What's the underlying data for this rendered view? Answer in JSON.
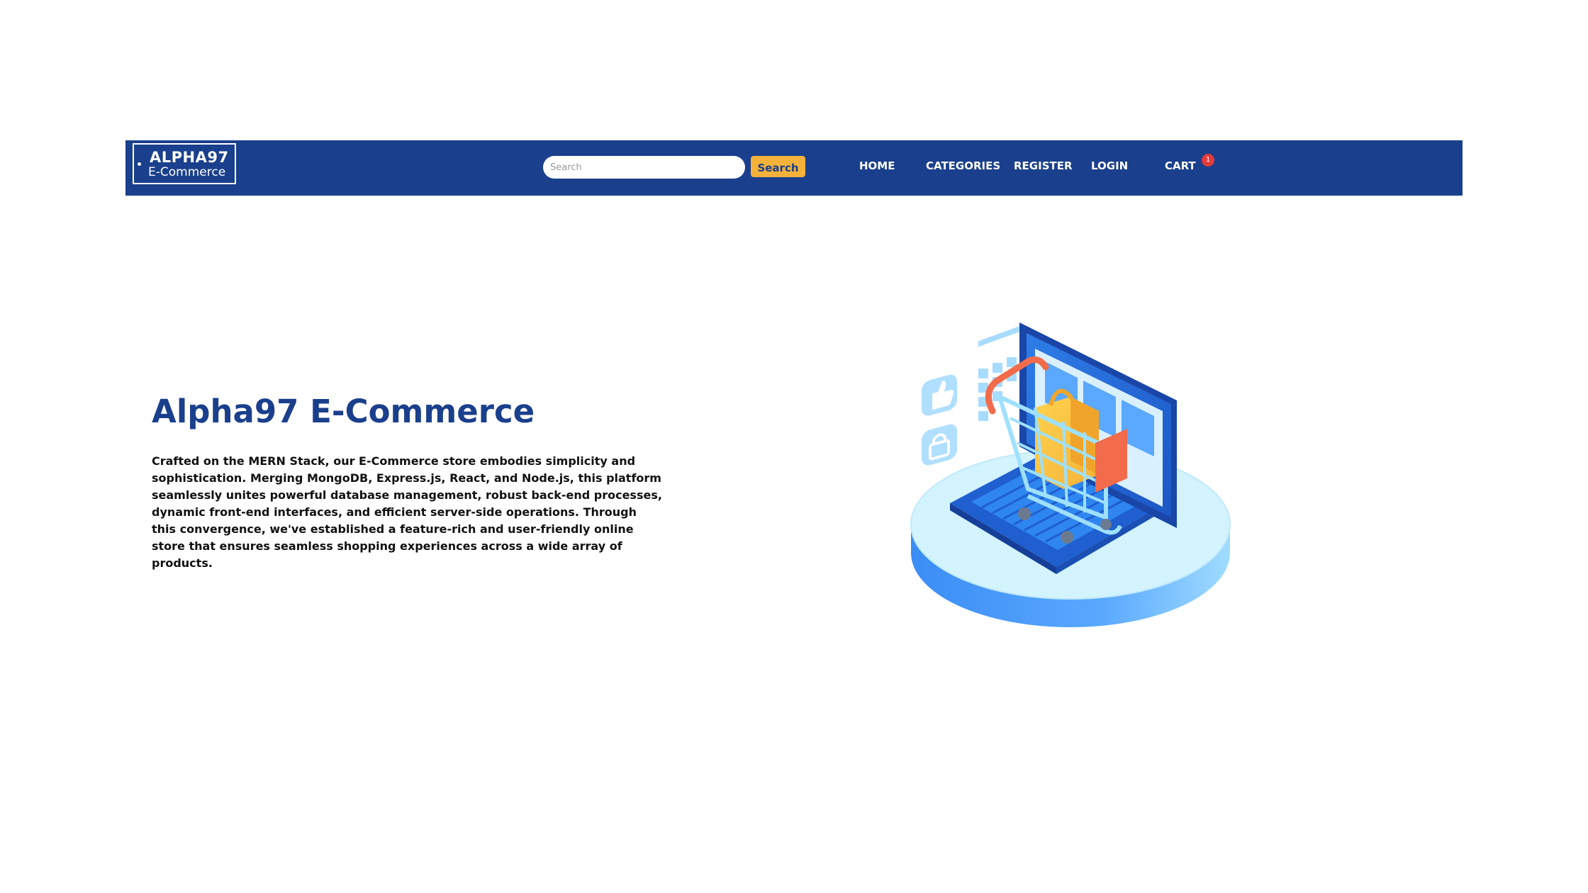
{
  "navbar": {
    "brand": {
      "line1": "ALPHA97",
      "line2": "E-Commerce"
    },
    "search": {
      "placeholder": "Search",
      "value": "",
      "button_label": "Search"
    },
    "links": {
      "home": "HOME",
      "categories": "CATEGORIES",
      "register": "REGISTER",
      "login": "LOGIN",
      "cart": "CART"
    },
    "cart_count": "1"
  },
  "hero": {
    "title": "Alpha97 E-Commerce",
    "description": "Crafted on the MERN Stack, our E-Commerce store embodies simplicity and sophistication. Merging MongoDB, Express.js, React, and Node.js, this platform seamlessly unites powerful database management, robust back-end processes, dynamic front-end interfaces, and efficient server-side operations. Through this convergence, we've established a feature-rich and user-friendly online store that ensures seamless shopping experiences across a wide array of products.",
    "illustration": "shopping-cart-laptop-illustration"
  },
  "colors": {
    "navbar_bg": "#1a3f8c",
    "accent": "#f4b23a",
    "title": "#1a3f8c",
    "badge": "#e23b3b"
  }
}
